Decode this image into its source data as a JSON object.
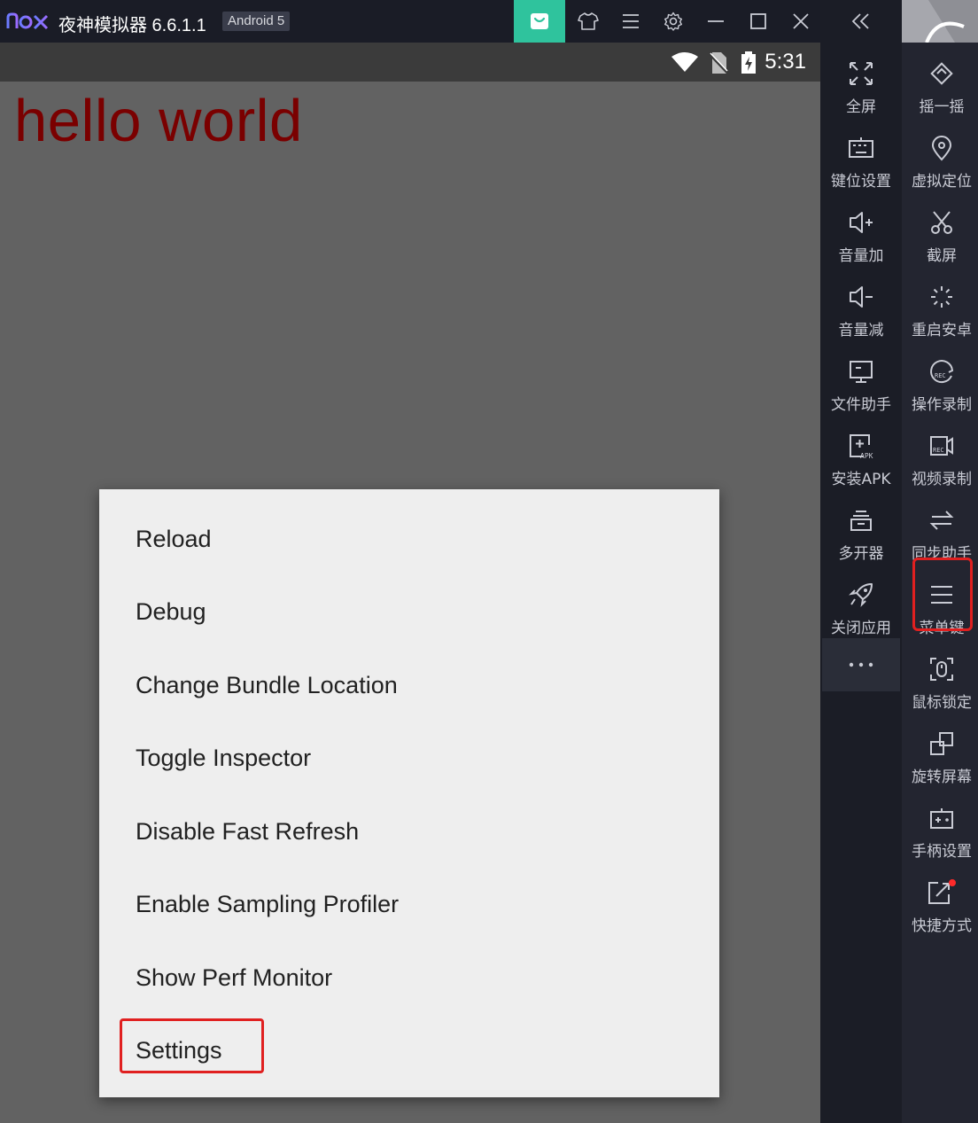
{
  "titlebar": {
    "app_title": "夜神模拟器 6.6.1.1",
    "android_badge": "Android 5",
    "logo_icon": "nox-logo",
    "buttons": [
      "store-icon",
      "skin-icon",
      "menu-icon",
      "settings-icon",
      "minimize-icon",
      "maximize-icon",
      "close-icon"
    ]
  },
  "statusbar": {
    "time": "5:31",
    "icons": [
      "wifi-icon",
      "no-sim-icon",
      "battery-charging-icon"
    ]
  },
  "screen": {
    "hello_text": "hello world",
    "hello_color": "#7a0000",
    "dev_menu": {
      "items": [
        "Reload",
        "Debug",
        "Change Bundle Location",
        "Toggle Inspector",
        "Disable Fast Refresh",
        "Enable Sampling Profiler",
        "Show Perf Monitor",
        "Settings"
      ],
      "highlighted_item": "Settings"
    }
  },
  "sidebar": {
    "collapse_icon": "double-chevron-left-icon",
    "left_column": [
      {
        "label": "全屏",
        "icon": "fullscreen-icon"
      },
      {
        "label": "键位设置",
        "icon": "keyboard-icon"
      },
      {
        "label": "音量加",
        "icon": "volume-up-icon"
      },
      {
        "label": "音量减",
        "icon": "volume-down-icon"
      },
      {
        "label": "文件助手",
        "icon": "file-monitor-icon"
      },
      {
        "label": "安装APK",
        "icon": "install-apk-icon"
      },
      {
        "label": "多开器",
        "icon": "multi-instance-icon"
      },
      {
        "label": "关闭应用",
        "icon": "rocket-icon"
      }
    ],
    "more_icon": "ellipsis-icon",
    "right_column": [
      {
        "label": "摇一摇",
        "icon": "shake-icon"
      },
      {
        "label": "虚拟定位",
        "icon": "location-pin-icon"
      },
      {
        "label": "截屏",
        "icon": "scissors-icon"
      },
      {
        "label": "重启安卓",
        "icon": "restart-icon"
      },
      {
        "label": "操作录制",
        "icon": "macro-record-icon"
      },
      {
        "label": "视频录制",
        "icon": "video-record-icon"
      },
      {
        "label": "同步助手",
        "icon": "sync-icon"
      },
      {
        "label": "菜单键",
        "icon": "menu-key-icon"
      },
      {
        "label": "鼠标锁定",
        "icon": "mouse-lock-icon"
      },
      {
        "label": "旋转屏幕",
        "icon": "rotate-screen-icon"
      },
      {
        "label": "手柄设置",
        "icon": "gamepad-icon"
      },
      {
        "label": "快捷方式",
        "icon": "shortcut-icon"
      }
    ],
    "highlighted_item": "菜单键"
  },
  "colors": {
    "accent_green": "#2fc39d",
    "highlight_red": "#e02020",
    "notification_dot": "#ff2a2a"
  }
}
